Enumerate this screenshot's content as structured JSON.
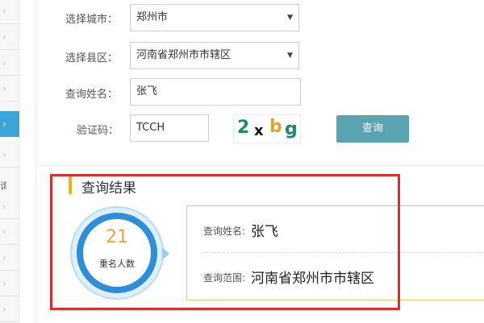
{
  "sidebar": {
    "chevron": "›",
    "fragment": "询",
    "items": [
      {
        "id": "item-1"
      },
      {
        "id": "item-2"
      },
      {
        "id": "item-3"
      },
      {
        "id": "item-4"
      },
      {
        "id": "item-5"
      },
      {
        "id": "item-6"
      },
      {
        "id": "item-7"
      },
      {
        "id": "item-8"
      },
      {
        "id": "item-9"
      },
      {
        "id": "item-10"
      },
      {
        "id": "item-11"
      },
      {
        "id": "item-12"
      }
    ]
  },
  "form": {
    "city_label": "选择城市：",
    "city_value": "郑州市",
    "district_label": "选择县区：",
    "district_value": "河南省郑州市市辖区",
    "name_label": "查询姓名：",
    "name_value": "张飞",
    "captcha_label": "验证码：",
    "captcha_input": "TCCH",
    "captcha_chars": [
      "2",
      "x",
      "b",
      "g"
    ],
    "captcha_colors": [
      "#1a8a6f",
      "#111111",
      "#e3a32a",
      "#1a8a6f"
    ],
    "query_button": "查询",
    "caret": "▼"
  },
  "result": {
    "title": "查询结果",
    "count": "21",
    "count_label": "重名人数",
    "name_label": "查询姓名:",
    "name_value": "张飞",
    "scope_label": "查询范围:",
    "scope_value": "河南省郑州市市辖区"
  },
  "colors": {
    "accent_blue": "#2e8fd8",
    "sidebar_active": "#3aa6d7",
    "button": "#5aa3b1",
    "title_bar": "#f2b415",
    "result_border": "#e8c567",
    "highlight_frame": "#e02b2b",
    "count": "#e9a43a"
  }
}
